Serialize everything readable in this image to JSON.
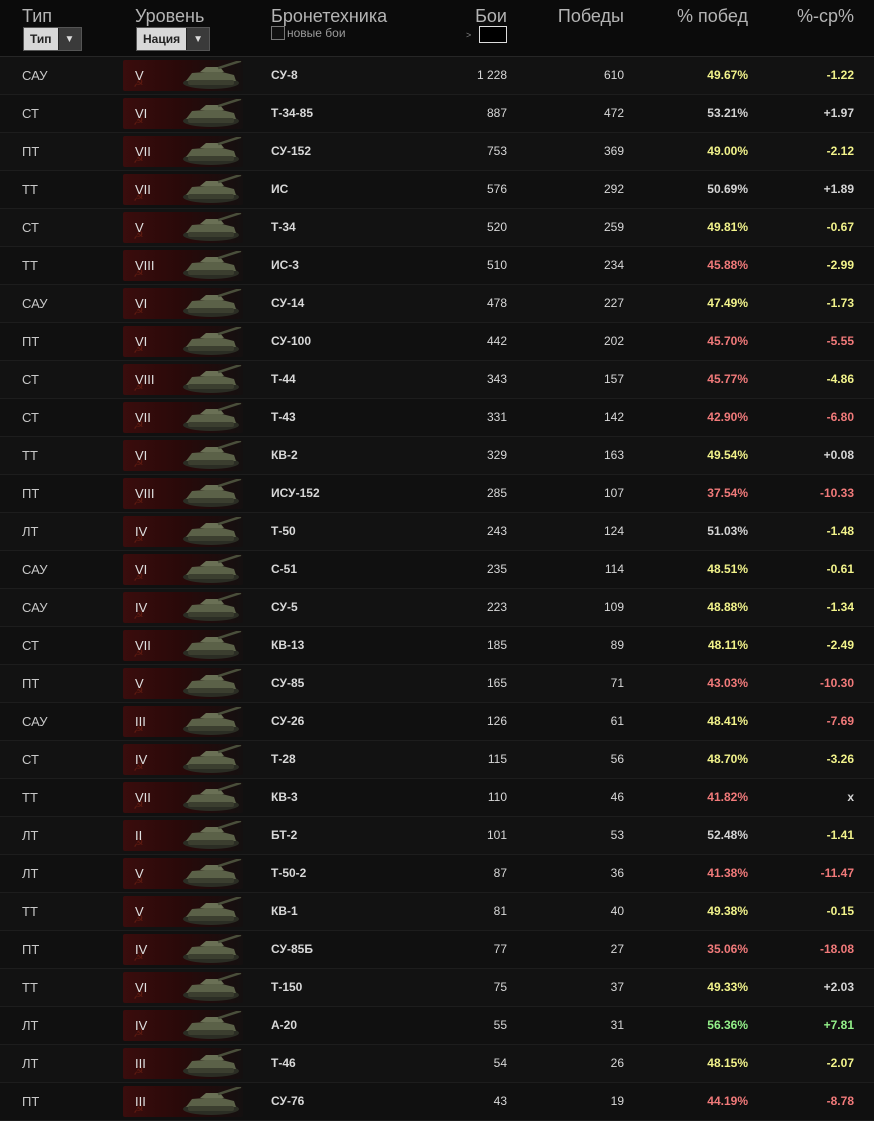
{
  "header": {
    "type_label": "Тип",
    "type_select": "Тип",
    "tier_label": "Уровень",
    "nation_select": "Нация",
    "vehicle_label": "Бронетехника",
    "new_battles_label": "новые бои",
    "battles_label": "Бои",
    "gt_symbol": ">",
    "wins_label": "Победы",
    "winrate_label": "% побед",
    "diff_label": "%-ср%"
  },
  "colors": {
    "good": "#94f28a",
    "avg": "#f2f38b",
    "bad": "#f17a7a",
    "neutral": "#d5d5d5"
  },
  "rows": [
    {
      "type": "САУ",
      "tier": "V",
      "name": "СУ-8",
      "battles": "1 228",
      "wins": "610",
      "pct": "49.67%",
      "pct_c": "yellow",
      "diff": "-1.22",
      "diff_c": "yellow"
    },
    {
      "type": "СТ",
      "tier": "VI",
      "name": "Т-34-85",
      "battles": "887",
      "wins": "472",
      "pct": "53.21%",
      "pct_c": "white",
      "diff": "+1.97",
      "diff_c": "white"
    },
    {
      "type": "ПТ",
      "tier": "VII",
      "name": "СУ-152",
      "battles": "753",
      "wins": "369",
      "pct": "49.00%",
      "pct_c": "yellow",
      "diff": "-2.12",
      "diff_c": "yellow"
    },
    {
      "type": "ТТ",
      "tier": "VII",
      "name": "ИС",
      "battles": "576",
      "wins": "292",
      "pct": "50.69%",
      "pct_c": "white",
      "diff": "+1.89",
      "diff_c": "white"
    },
    {
      "type": "СТ",
      "tier": "V",
      "name": "Т-34",
      "battles": "520",
      "wins": "259",
      "pct": "49.81%",
      "pct_c": "yellow",
      "diff": "-0.67",
      "diff_c": "yellow"
    },
    {
      "type": "ТТ",
      "tier": "VIII",
      "name": "ИС-3",
      "battles": "510",
      "wins": "234",
      "pct": "45.88%",
      "pct_c": "red",
      "diff": "-2.99",
      "diff_c": "yellow"
    },
    {
      "type": "САУ",
      "tier": "VI",
      "name": "СУ-14",
      "battles": "478",
      "wins": "227",
      "pct": "47.49%",
      "pct_c": "yellow",
      "diff": "-1.73",
      "diff_c": "yellow"
    },
    {
      "type": "ПТ",
      "tier": "VI",
      "name": "СУ-100",
      "battles": "442",
      "wins": "202",
      "pct": "45.70%",
      "pct_c": "red",
      "diff": "-5.55",
      "diff_c": "red"
    },
    {
      "type": "СТ",
      "tier": "VIII",
      "name": "Т-44",
      "battles": "343",
      "wins": "157",
      "pct": "45.77%",
      "pct_c": "red",
      "diff": "-4.86",
      "diff_c": "yellow"
    },
    {
      "type": "СТ",
      "tier": "VII",
      "name": "Т-43",
      "battles": "331",
      "wins": "142",
      "pct": "42.90%",
      "pct_c": "red",
      "diff": "-6.80",
      "diff_c": "red"
    },
    {
      "type": "ТТ",
      "tier": "VI",
      "name": "КВ-2",
      "battles": "329",
      "wins": "163",
      "pct": "49.54%",
      "pct_c": "yellow",
      "diff": "+0.08",
      "diff_c": "white"
    },
    {
      "type": "ПТ",
      "tier": "VIII",
      "name": "ИСУ-152",
      "battles": "285",
      "wins": "107",
      "pct": "37.54%",
      "pct_c": "red",
      "diff": "-10.33",
      "diff_c": "red"
    },
    {
      "type": "ЛТ",
      "tier": "IV",
      "name": "Т-50",
      "battles": "243",
      "wins": "124",
      "pct": "51.03%",
      "pct_c": "white",
      "diff": "-1.48",
      "diff_c": "yellow"
    },
    {
      "type": "САУ",
      "tier": "VI",
      "name": "С-51",
      "battles": "235",
      "wins": "114",
      "pct": "48.51%",
      "pct_c": "yellow",
      "diff": "-0.61",
      "diff_c": "yellow"
    },
    {
      "type": "САУ",
      "tier": "IV",
      "name": "СУ-5",
      "battles": "223",
      "wins": "109",
      "pct": "48.88%",
      "pct_c": "yellow",
      "diff": "-1.34",
      "diff_c": "yellow"
    },
    {
      "type": "СТ",
      "tier": "VII",
      "name": "КВ-13",
      "battles": "185",
      "wins": "89",
      "pct": "48.11%",
      "pct_c": "yellow",
      "diff": "-2.49",
      "diff_c": "yellow"
    },
    {
      "type": "ПТ",
      "tier": "V",
      "name": "СУ-85",
      "battles": "165",
      "wins": "71",
      "pct": "43.03%",
      "pct_c": "red",
      "diff": "-10.30",
      "diff_c": "red"
    },
    {
      "type": "САУ",
      "tier": "III",
      "name": "СУ-26",
      "battles": "126",
      "wins": "61",
      "pct": "48.41%",
      "pct_c": "yellow",
      "diff": "-7.69",
      "diff_c": "red"
    },
    {
      "type": "СТ",
      "tier": "IV",
      "name": "Т-28",
      "battles": "115",
      "wins": "56",
      "pct": "48.70%",
      "pct_c": "yellow",
      "diff": "-3.26",
      "diff_c": "yellow"
    },
    {
      "type": "ТТ",
      "tier": "VII",
      "name": "КВ-3",
      "battles": "110",
      "wins": "46",
      "pct": "41.82%",
      "pct_c": "red",
      "diff": "x",
      "diff_c": "white"
    },
    {
      "type": "ЛТ",
      "tier": "II",
      "name": "БТ-2",
      "battles": "101",
      "wins": "53",
      "pct": "52.48%",
      "pct_c": "white",
      "diff": "-1.41",
      "diff_c": "yellow"
    },
    {
      "type": "ЛТ",
      "tier": "V",
      "name": "Т-50-2",
      "battles": "87",
      "wins": "36",
      "pct": "41.38%",
      "pct_c": "red",
      "diff": "-11.47",
      "diff_c": "red"
    },
    {
      "type": "ТТ",
      "tier": "V",
      "name": "КВ-1",
      "battles": "81",
      "wins": "40",
      "pct": "49.38%",
      "pct_c": "yellow",
      "diff": "-0.15",
      "diff_c": "yellow"
    },
    {
      "type": "ПТ",
      "tier": "IV",
      "name": "СУ-85Б",
      "battles": "77",
      "wins": "27",
      "pct": "35.06%",
      "pct_c": "red",
      "diff": "-18.08",
      "diff_c": "red"
    },
    {
      "type": "ТТ",
      "tier": "VI",
      "name": "Т-150",
      "battles": "75",
      "wins": "37",
      "pct": "49.33%",
      "pct_c": "yellow",
      "diff": "+2.03",
      "diff_c": "white"
    },
    {
      "type": "ЛТ",
      "tier": "IV",
      "name": "А-20",
      "battles": "55",
      "wins": "31",
      "pct": "56.36%",
      "pct_c": "green",
      "diff": "+7.81",
      "diff_c": "green"
    },
    {
      "type": "ЛТ",
      "tier": "III",
      "name": "Т-46",
      "battles": "54",
      "wins": "26",
      "pct": "48.15%",
      "pct_c": "yellow",
      "diff": "-2.07",
      "diff_c": "yellow"
    },
    {
      "type": "ПТ",
      "tier": "III",
      "name": "СУ-76",
      "battles": "43",
      "wins": "19",
      "pct": "44.19%",
      "pct_c": "red",
      "diff": "-8.78",
      "diff_c": "red"
    }
  ]
}
